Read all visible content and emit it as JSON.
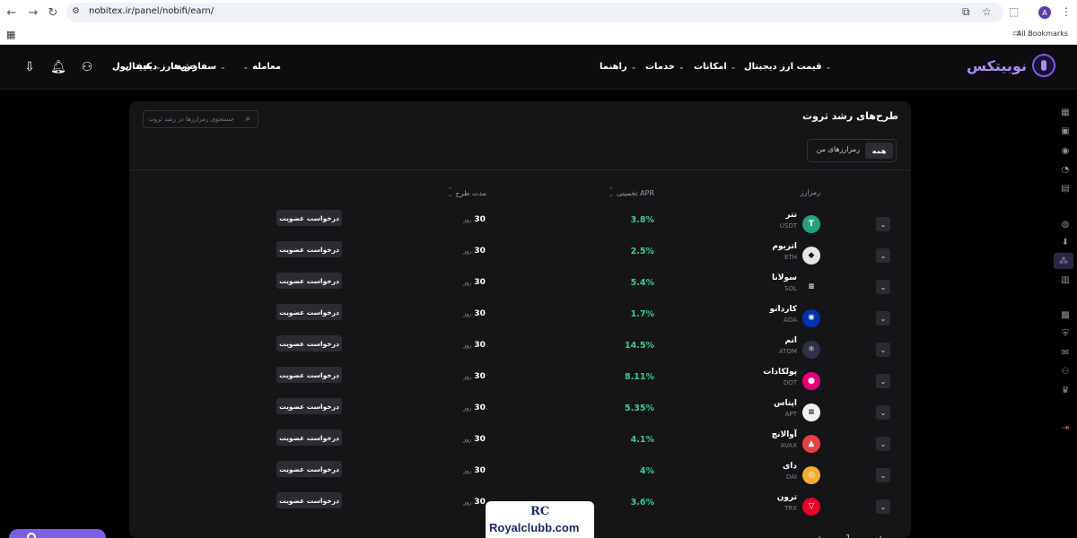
{
  "browser": {
    "url": "nobitex.ir/panel/nobifi/earn/",
    "bookmarks_label": "All Bookmarks",
    "profile_initial": "A"
  },
  "header": {
    "logo_text": "نوبیتکس",
    "nav": [
      {
        "label": "معامله"
      },
      {
        "label": "خرید ارز دیجیتال"
      },
      {
        "label": "قیمت ارز دیجیتال"
      },
      {
        "label": "امکانات"
      },
      {
        "label": "خدمات"
      },
      {
        "label": "راهنما"
      }
    ],
    "wallet_label": "کیف پول",
    "orders_label": "سفارش‌ها"
  },
  "page": {
    "title": "طرح‌های رشد ثروت",
    "search_placeholder": "جستجوی رمزارزها در رشد ثروت",
    "tabs": {
      "all": "همه",
      "mine": "رمزارزهای من"
    },
    "columns": {
      "coin": "رمزارز",
      "apr": "APR تخمینی",
      "duration": "مدت طرح"
    },
    "duration_unit": "روز",
    "request_label": "درخواست عضویت"
  },
  "rows": [
    {
      "name": "تتر",
      "symbol": "USDT",
      "apr": "3.8%",
      "duration": "30",
      "color": "#26a17b",
      "glyph": "T"
    },
    {
      "name": "اتریوم",
      "symbol": "ETH",
      "apr": "2.5%",
      "duration": "30",
      "color": "#e6e6e6",
      "glyph": "◆"
    },
    {
      "name": "سولانا",
      "symbol": "SOL",
      "apr": "5.4%",
      "duration": "30",
      "color": "#151518",
      "glyph": "≡"
    },
    {
      "name": "کاردانو",
      "symbol": "ADA",
      "apr": "1.7%",
      "duration": "30",
      "color": "#0033ad",
      "glyph": "✺"
    },
    {
      "name": "اتم",
      "symbol": "ATOM",
      "apr": "14.5%",
      "duration": "30",
      "color": "#2e3148",
      "glyph": "⚛"
    },
    {
      "name": "پولکادات",
      "symbol": "DOT",
      "apr": "8.11%",
      "duration": "30",
      "color": "#e6007a",
      "glyph": "●"
    },
    {
      "name": "اپتاس",
      "symbol": "APT",
      "apr": "5.35%",
      "duration": "30",
      "color": "#f0f0f0",
      "glyph": "≡"
    },
    {
      "name": "آوالانچ",
      "symbol": "AVAX",
      "apr": "4.1%",
      "duration": "30",
      "color": "#e84142",
      "glyph": "▲"
    },
    {
      "name": "دای",
      "symbol": "DAI",
      "apr": "4%",
      "duration": "30",
      "color": "#f5ac37",
      "glyph": "◎"
    },
    {
      "name": "ترون",
      "symbol": "TRX",
      "apr": "3.6%",
      "duration": "30",
      "color": "#eb0029",
      "glyph": "▽"
    }
  ],
  "pagination": {
    "current": "1"
  },
  "watermark": {
    "mark": "RC",
    "text": "Royalclubb.com"
  }
}
